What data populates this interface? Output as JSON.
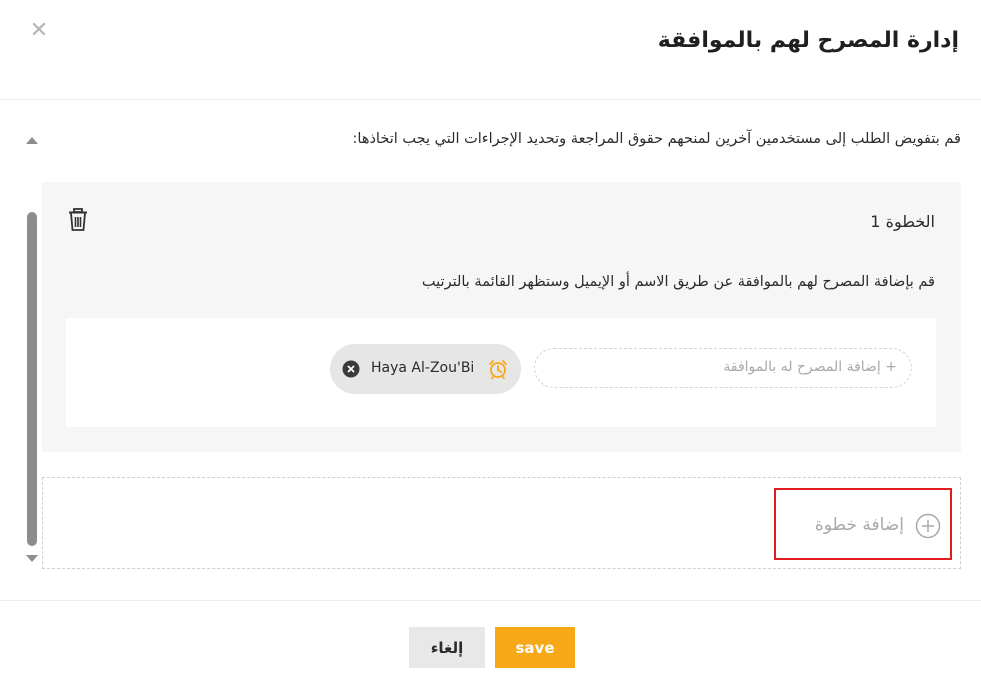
{
  "dialog": {
    "title": "إدارة المصرح لهم بالموافقة",
    "close_icon": "close-icon"
  },
  "intro_text": "قم بتفويض الطلب إلى مستخدمين آخرين لمنحهم حقوق المراجعة وتحديد الإجراءات التي يجب اتخاذها:",
  "steps": [
    {
      "title": "الخطوة 1",
      "description": "قم بإضافة المصرح لهم بالموافقة عن طريق الاسم أو الإيميل وستظهر القائمة بالترتيب",
      "add_approver_placeholder": "+ إضافة المصرح له بالموافقة",
      "approvers": [
        {
          "name": "Haya Al-Zou'Bi",
          "icon": "alarm-clock-icon"
        }
      ]
    }
  ],
  "add_step_label": "إضافة خطوة",
  "footer": {
    "cancel_label": "إلغاء",
    "save_label": "save"
  },
  "colors": {
    "accent": "#f6a817",
    "highlight_border": "#e01d1d",
    "card_bg": "#f6f6f6",
    "chip_bg": "#e6e6e6"
  }
}
